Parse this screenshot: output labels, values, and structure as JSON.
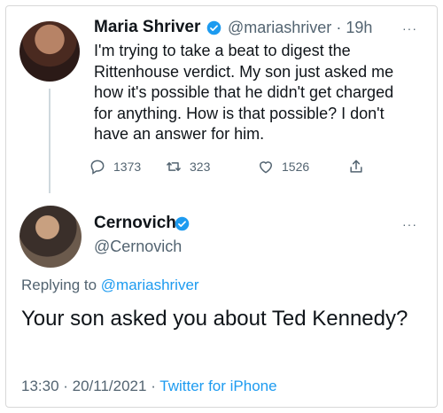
{
  "tweet1": {
    "author_name": "Maria Shriver",
    "handle": "@mariashriver",
    "time": "19h",
    "text": "I'm trying to take a beat to digest the Rittenhouse verdict. My son just asked me how it's possible that he didn't get charged for anything. How is that possible? I don't have an answer for him.",
    "reply_count": "1373",
    "retweet_count": "323",
    "like_count": "1526"
  },
  "tweet2": {
    "author_name": "Cernovich",
    "handle": "@Cernovich",
    "replying_prefix": "Replying to",
    "replying_to": "@mariashriver",
    "text": "Your son asked you about Ted Kennedy?",
    "timestamp": "13:30 · 20/11/2021 ·",
    "source": "Twitter for iPhone"
  },
  "icons": {
    "verified": "verified-badge-icon",
    "reply": "reply-icon",
    "retweet": "retweet-icon",
    "like": "heart-icon",
    "share": "share-icon",
    "more": "more-icon"
  },
  "colors": {
    "accent": "#1d9bf0",
    "secondary_text": "#536471"
  }
}
